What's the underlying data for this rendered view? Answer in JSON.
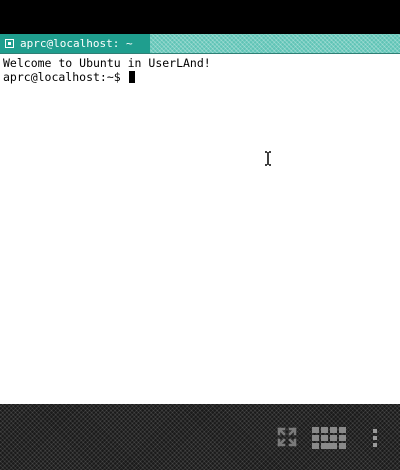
{
  "window": {
    "title": "aprc@localhost: ~"
  },
  "terminal": {
    "lines": [
      "Welcome to Ubuntu in UserLAnd!",
      "aprc@localhost:~$ "
    ]
  },
  "icons": {
    "window_menu": "menu-box-icon",
    "pointer": "ibeam-cursor-icon",
    "fullscreen": "fullscreen-icon",
    "keyboard": "keyboard-icon",
    "overflow": "overflow-menu-icon"
  },
  "colors": {
    "title_bar": "#5fc4b6",
    "title_tab": "#1f9e8e",
    "terminal_bg": "#ffffff",
    "terminal_fg": "#000000"
  }
}
